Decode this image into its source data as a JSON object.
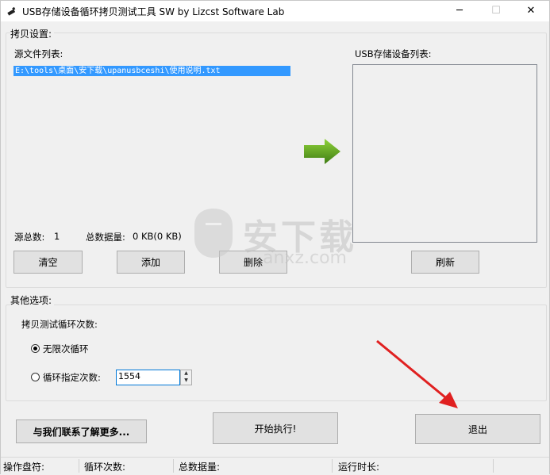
{
  "window": {
    "title": "USB存储设备循环拷贝测试工具 SW  by Lizcst Software Lab",
    "minimize_glyph": "─",
    "maximize_glyph": "☐",
    "close_glyph": "✕"
  },
  "copy_settings": {
    "group_label": "拷贝设置:",
    "source_list_label": "源文件列表:",
    "source_files": [
      "E:\\tools\\桌面\\安下载\\upanusbceshi\\使用说明.txt"
    ],
    "source_count_label": "源总数:",
    "source_count": "1",
    "total_size_label": "总数据量:",
    "total_size": "0 KB(0 KB)",
    "clear_button": "清空",
    "add_button": "添加",
    "delete_button": "删除",
    "usb_list_label": "USB存储设备列表:",
    "refresh_button": "刷新",
    "arrow_color": "#5a9a1e"
  },
  "other_options": {
    "group_label": "其他选项:",
    "loop_count_label": "拷贝测试循环次数:",
    "radio_unlimited": "无限次循环",
    "radio_specified": "循环指定次数:",
    "loop_count_value": "1554",
    "selected": "unlimited"
  },
  "actions": {
    "contact_button": "与我们联系了解更多...",
    "start_button": "开始执行!",
    "exit_button": "退出"
  },
  "statusbar": {
    "disk_label": "操作盘符:",
    "loops_label": "循环次数:",
    "total_label": "总数据量:",
    "runtime_label": "运行时长:"
  },
  "watermark": {
    "text": "安下载",
    "sub_text": "anxz.com"
  },
  "annotation": {
    "arrow_color": "#e02020"
  }
}
